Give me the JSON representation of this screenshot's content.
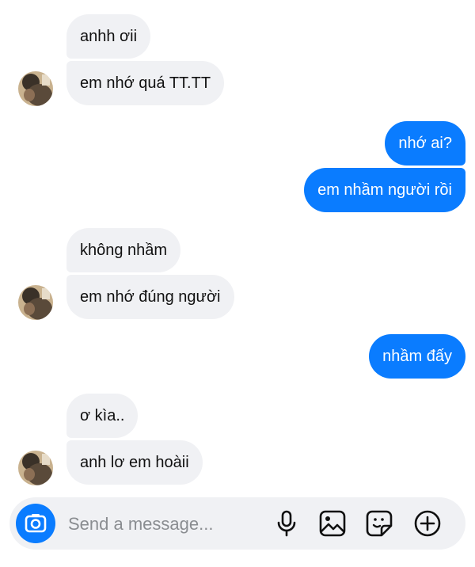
{
  "messages": [
    {
      "direction": "incoming",
      "text": "anhh ơii"
    },
    {
      "direction": "incoming",
      "text": "em nhớ quá TT.TT"
    },
    {
      "direction": "outgoing",
      "text": "nhớ ai?"
    },
    {
      "direction": "outgoing",
      "text": "em nhầm người rồi"
    },
    {
      "direction": "incoming",
      "text": "không nhầm"
    },
    {
      "direction": "incoming",
      "text": "em nhớ đúng người"
    },
    {
      "direction": "outgoing",
      "text": "nhầm đấy"
    },
    {
      "direction": "incoming",
      "text": "ơ kìa.."
    },
    {
      "direction": "incoming",
      "text": "anh lơ em hoàii"
    }
  ],
  "composer": {
    "placeholder": "Send a message...",
    "value": "",
    "icons": [
      "camera-icon",
      "microphone-icon",
      "gallery-icon",
      "sticker-icon",
      "plus-circle-icon"
    ]
  },
  "colors": {
    "incoming_bubble": "#f0f1f4",
    "outgoing_bubble": "#0a7cff",
    "accent": "#0a7cff"
  }
}
